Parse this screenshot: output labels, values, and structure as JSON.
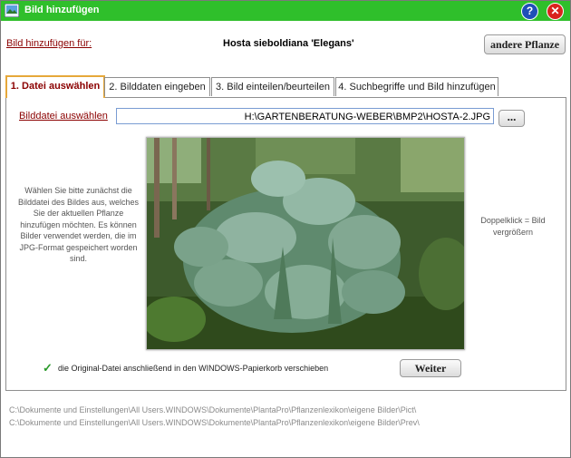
{
  "window": {
    "title": "Bild hinzufügen"
  },
  "header": {
    "for_label": "Bild hinzufügen für:",
    "plant_name": "Hosta sieboldiana 'Elegans'",
    "other_plant_button": "andere Pflanze"
  },
  "tabs": [
    {
      "label": "1. Datei auswählen",
      "active": true
    },
    {
      "label": "2. Bilddaten eingeben",
      "active": false
    },
    {
      "label": "3. Bild einteilen/beurteilen",
      "active": false
    },
    {
      "label": "4. Suchbegriffe und Bild hinzufügen",
      "active": false
    }
  ],
  "file": {
    "label": "Bilddatei auswählen",
    "value": "H:\\GARTENBERATUNG-WEBER\\BMP2\\HOSTA-2.JPG",
    "browse_button": "..."
  },
  "help_text": "Wählen Sie bitte zunächst die Bilddatei des Bildes aus, welches Sie der aktuellen Pflanze hinzufügen möchten. Es können Bilder verwendet werden, die im JPG-Format gespeichert worden sind.",
  "dblclick_text": "Doppelklick = Bild vergrößern",
  "option": {
    "checked": true,
    "label": "die Original-Datei anschließend in den WINDOWS-Papierkorb verschieben"
  },
  "next_button": "Weiter",
  "paths": [
    "C:\\Dokumente und Einstellungen\\All Users.WINDOWS\\Dokumente\\PlantaPro\\Pflanzenlexikon\\eigene Bilder\\Pict\\",
    "C:\\Dokumente und Einstellungen\\All Users.WINDOWS\\Dokumente\\PlantaPro\\Pflanzenlexikon\\eigene Bilder\\Prev\\"
  ],
  "colors": {
    "titlebar": "#2fbf2b",
    "active_tab_border": "#e6a83a",
    "link": "#8b0000"
  },
  "icons": {
    "app": "app-icon",
    "help": "help-icon",
    "close": "close-icon",
    "check": "checkmark-icon"
  }
}
